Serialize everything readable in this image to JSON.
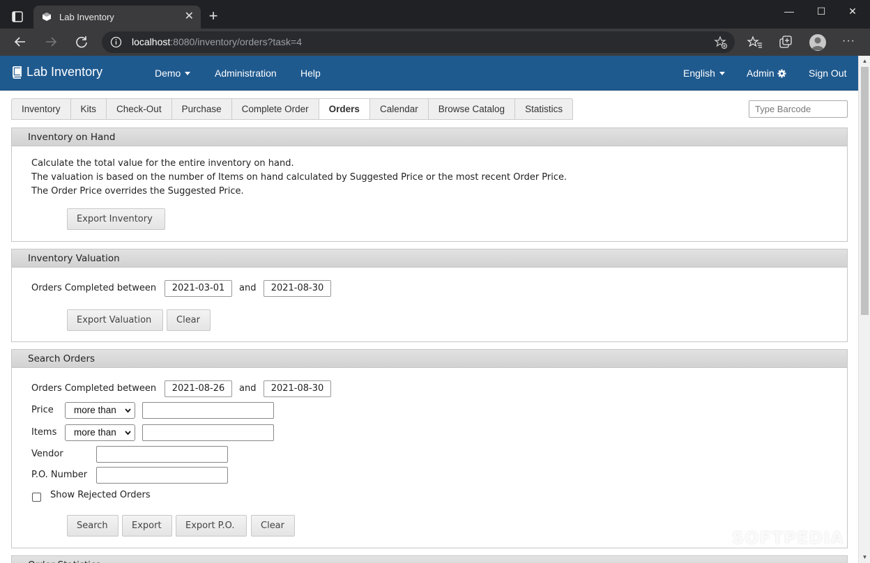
{
  "browser": {
    "tab_title": "Lab Inventory",
    "url_host": "localhost",
    "url_rest": ":8080/inventory/orders?task=4",
    "win_min": "—",
    "win_max": "☐",
    "win_close": "✕",
    "menu": "···"
  },
  "app": {
    "brand": "Lab Inventory",
    "nav": {
      "demo": "Demo",
      "administration": "Administration",
      "help": "Help",
      "language": "English",
      "admin": "Admin",
      "sign_out": "Sign Out"
    },
    "tabs": [
      "Inventory",
      "Kits",
      "Check-Out",
      "Purchase",
      "Complete Order",
      "Orders",
      "Calendar",
      "Browse Catalog",
      "Statistics"
    ],
    "active_tab": "Orders",
    "barcode_placeholder": "Type Barcode"
  },
  "on_hand": {
    "title": "Inventory on Hand",
    "line1": "Calculate the total value for the entire inventory on hand.",
    "line2": "The valuation is based on the number of Items on hand calculated by Suggested Price or the most recent Order Price.",
    "line3": "The Order Price overrides the Suggested Price.",
    "export_btn": "Export Inventory"
  },
  "valuation": {
    "title": "Inventory Valuation",
    "label": "Orders Completed between",
    "date_from": "2021-03-01",
    "and": "and",
    "date_to": "2021-08-30",
    "export_btn": "Export Valuation",
    "clear_btn": "Clear"
  },
  "search": {
    "title": "Search Orders",
    "label": "Orders Completed between",
    "date_from": "2021-08-26",
    "and": "and",
    "date_to": "2021-08-30",
    "price_label": "Price",
    "price_op": "more than",
    "price_value": "",
    "items_label": "Items",
    "items_op": "more than",
    "items_value": "",
    "vendor_label": "Vendor",
    "vendor_value": "",
    "po_label": "P.O. Number",
    "po_value": "",
    "rejected_label": "Show Rejected Orders",
    "search_btn": "Search",
    "export_btn": "Export",
    "export_po_btn": "Export P.O.",
    "clear_btn": "Clear"
  },
  "next_panel_title": "Order Statistics",
  "watermark": "SOFTPEDIA",
  "colors": {
    "nav": "#1f5a8f",
    "chrome": "#202124",
    "addressbar": "#3b3b3d"
  }
}
